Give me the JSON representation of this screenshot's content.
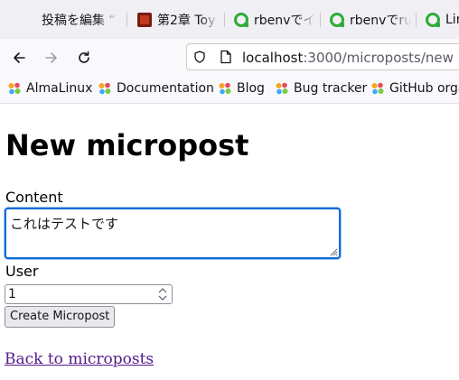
{
  "browser": {
    "tabs": [
      {
        "label": "投稿を編集 “"
      },
      {
        "label": "第2章 Toy"
      },
      {
        "label": "rbenvでイ"
      },
      {
        "label": "rbenvでru"
      },
      {
        "label": "Lin"
      }
    ],
    "url": {
      "host": "localhost",
      "path": ":3000/microposts/new"
    },
    "bookmarks": [
      "AlmaLinux",
      "Documentation",
      "Blog",
      "Bug tracker",
      "GitHub orga"
    ]
  },
  "page": {
    "heading": "New micropost",
    "content_label": "Content",
    "content_value": "これはテストです",
    "user_label": "User",
    "user_value": "1",
    "submit_label": "Create Micropost",
    "back_link": "Back to microposts"
  },
  "colors": {
    "accent_focus": "#0a6ad6",
    "link_visited": "#551a8b",
    "favicon_green": "#2dab3a"
  }
}
